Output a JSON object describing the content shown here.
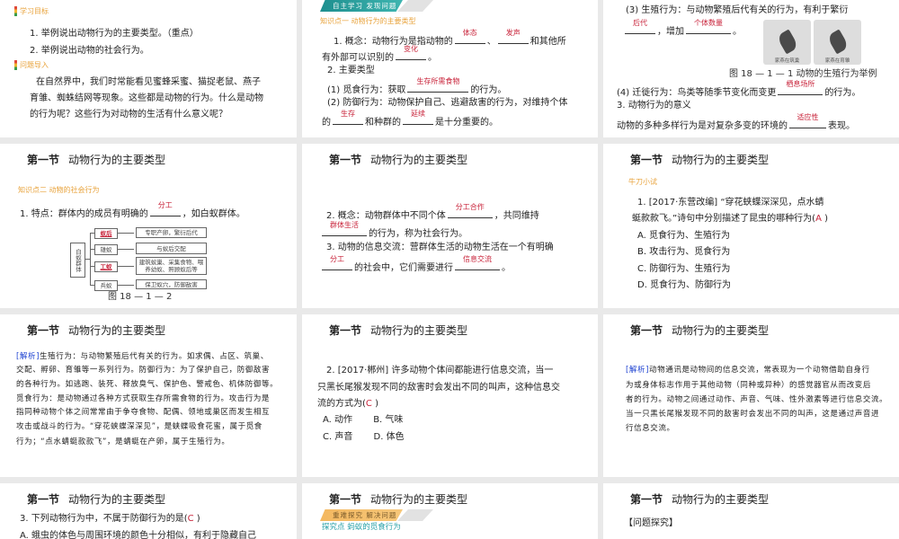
{
  "header": {
    "section": "第一节",
    "name": "动物行为的主要类型"
  },
  "slides": [
    {
      "blocks": [
        {
          "type": "tag",
          "text": "学习目标",
          "bar": true
        },
        {
          "type": "p",
          "segs": [
            "1. 举例说出动物行为的主要类型。（重点）"
          ]
        },
        {
          "type": "p",
          "segs": [
            "2. 举例说出动物的社会行为。"
          ]
        },
        {
          "type": "tag",
          "text": "问题导入",
          "bar": true
        },
        {
          "type": "p",
          "segs": [
            "在自然界中，我们时常能看见蜜蜂采蜜、猫捉老鼠、燕子"
          ]
        },
        {
          "type": "p",
          "segs": [
            "育雏、蜘蛛结网等现象。这些都是动物的行为。什么是动物"
          ]
        },
        {
          "type": "p",
          "segs": [
            "的行为呢？这些行为对动物的生活有什么意义呢？"
          ]
        }
      ]
    },
    {
      "banner": {
        "text": "自主学习 发现问题",
        "style": "teal"
      },
      "blocks": [
        {
          "type": "tag",
          "text": "知识点一  动物行为的主要类型"
        },
        {
          "type": "p",
          "segs": [
            "1. 概念：动物行为是指动物的",
            {
              "blank": "体态"
            },
            "、",
            {
              "blank": "发声"
            },
            "和其他所"
          ]
        },
        {
          "type": "p",
          "segs": [
            "有外部可以识别的",
            {
              "blank": "变化"
            },
            "。"
          ]
        },
        {
          "type": "p",
          "segs": [
            "2. 主要类型"
          ]
        },
        {
          "type": "p",
          "segs": [
            "(1) 觅食行为：获取",
            {
              "blank": "生存所需食物"
            },
            "的行为。"
          ]
        },
        {
          "type": "p",
          "segs": [
            "(2) 防御行为：动物保护自己、逃避敌害的行为，对维持个体"
          ]
        },
        {
          "type": "p",
          "segs": [
            "的",
            {
              "blank": "生存"
            },
            "和种群的",
            {
              "blank": "延续"
            },
            "是十分重要的。"
          ]
        }
      ]
    },
    {
      "photos": [
        "家燕在筑巢",
        "家燕在育雏"
      ],
      "blocks": [
        {
          "type": "p",
          "segs": [
            "(3) 生殖行为：与动物繁殖后代有关的行为，有利于繁衍"
          ]
        },
        {
          "type": "p",
          "segs": [
            {
              "blank": "后代"
            },
            "，增加",
            {
              "blank": "个体数量"
            },
            "。"
          ]
        },
        {
          "type": "caption",
          "text": "图 18 — 1 — 1  动物的生殖行为举例"
        },
        {
          "type": "p",
          "segs": [
            "(4) 迁徙行为：鸟类等随季节变化而变更",
            {
              "blank": "栖息场所"
            },
            "的行为。"
          ]
        },
        {
          "type": "p",
          "segs": [
            "3. 动物行为的意义"
          ]
        },
        {
          "type": "p",
          "segs": [
            "动物的多种多样行为是对复杂多变的环境的",
            {
              "blank": "适应性"
            },
            "表现。"
          ]
        }
      ]
    },
    {
      "title": true,
      "diagram": {
        "root": "白蚁群体",
        "rows": [
          {
            "role": "蚁后",
            "desc": "专职产卵，繁衍后代",
            "highlight": true
          },
          {
            "role": "雄蚁",
            "desc": "与蚁后交配",
            "highlight": false
          },
          {
            "role": "工蚁",
            "desc": "建筑蚁巢、采集食物、喂养幼蚁、照顾蚁后等",
            "highlight": true
          },
          {
            "role": "兵蚁",
            "desc": "保卫蚁穴，防御敌害",
            "highlight": false
          }
        ]
      },
      "blocks": [
        {
          "type": "tag",
          "text": "知识点二  动物的社会行为"
        },
        {
          "type": "p",
          "segs": [
            "1. 特点：群体内的成员有明确的",
            {
              "blank": "分工"
            },
            "，如白蚁群体。"
          ]
        },
        {
          "type": "caption",
          "text": "图 18 — 1 — 2"
        }
      ]
    },
    {
      "title": true,
      "blocks": [
        {
          "type": "p",
          "segs": [
            "2. 概念：动物群体中不同个体",
            {
              "blank": "分工合作"
            },
            "，共同维持"
          ]
        },
        {
          "type": "p",
          "segs": [
            {
              "blank": "群体生活"
            },
            "的行为，称为社会行为。"
          ]
        },
        {
          "type": "p",
          "segs": [
            "3. 动物的信息交流：营群体生活的动物生活在一个有明确"
          ]
        },
        {
          "type": "p",
          "segs": [
            {
              "blank": "分工"
            },
            "的社会中，它们需要进行",
            {
              "blank": "信息交流"
            },
            "。"
          ]
        }
      ]
    },
    {
      "title": true,
      "blocks": [
        {
          "type": "tag",
          "text": "牛刀小试"
        },
        {
          "type": "p",
          "segs": [
            "1. [2017·东营改编] “穿花蛱蝶深深见，点水蜻"
          ]
        },
        {
          "type": "p",
          "segs": [
            "蜓款款飞。”诗句中分别描述了昆虫的哪种行为(",
            {
              "ans": "A"
            },
            " )"
          ]
        },
        {
          "type": "p",
          "segs": [
            "A. 觅食行为、生殖行为"
          ]
        },
        {
          "type": "p",
          "segs": [
            "B. 攻击行为、觅食行为"
          ]
        },
        {
          "type": "p",
          "segs": [
            "C. 防御行为、生殖行为"
          ]
        },
        {
          "type": "p",
          "segs": [
            "D. 觅食行为、防御行为"
          ]
        }
      ]
    },
    {
      "title": true,
      "blocks": [
        {
          "type": "s",
          "segs": [
            {
              "label": "[解析]"
            },
            "生殖行为：与动物繁殖后代有关的行为。如求偶、占区、筑巢、"
          ]
        },
        {
          "type": "s",
          "segs": [
            "交配、孵卵、育雏等一系列行为。防御行为：为了保护自己，防御敌害"
          ]
        },
        {
          "type": "s",
          "segs": [
            "的各种行为。如逃跑、装死、释放臭气、保护色、警戒色、机体防御等。"
          ]
        },
        {
          "type": "s",
          "segs": [
            "觅食行为：是动物通过各种方式获取生存所需食物的行为。攻击行为是"
          ]
        },
        {
          "type": "s",
          "segs": [
            "指同种动物个体之间常常由于争夺食物、配偶、领地或巢区而发生相互"
          ]
        },
        {
          "type": "s",
          "segs": [
            "攻击或战斗的行为。“穿花蛱蝶深深见”，是蛱蝶吸食花蜜，属于觅食"
          ]
        },
        {
          "type": "s",
          "segs": [
            "行为；“点水蜻蜓款款飞”，是蜻蜓在产卵，属于生殖行为。"
          ]
        }
      ]
    },
    {
      "title": true,
      "blocks": [
        {
          "type": "p",
          "segs": [
            "2. [2017·郴州] 许多动物个体间都能进行信息交流，当一"
          ]
        },
        {
          "type": "p",
          "segs": [
            "只黑长尾猴发现不同的敌害时会发出不同的叫声，这种信息交"
          ]
        },
        {
          "type": "p",
          "segs": [
            "流的方式为(",
            {
              "ans": "C"
            },
            " )"
          ]
        },
        {
          "type": "p",
          "segs": [
            "A. 动作　　 B. 气味"
          ]
        },
        {
          "type": "p",
          "segs": [
            "C. 声音　　 D. 体色"
          ]
        }
      ]
    },
    {
      "title": true,
      "blocks": [
        {
          "type": "s",
          "segs": [
            {
              "label": "[解析]"
            },
            "动物通讯是动物间的信息交流，常表现为一个动物借助自身行"
          ]
        },
        {
          "type": "s",
          "segs": [
            "为或身体标志作用于其他动物（同种或异种）的感觉器官从而改变后"
          ]
        },
        {
          "type": "s",
          "segs": [
            "者的行为。动物之间通过动作、声音、气味、性外激素等进行信息交流。"
          ]
        },
        {
          "type": "s",
          "segs": [
            "当一只黑长尾猴发现不同的敌害时会发出不同的叫声，这是通过声音进"
          ]
        },
        {
          "type": "s",
          "segs": [
            "行信息交流。"
          ]
        }
      ]
    },
    {
      "title": true,
      "blocks": [
        {
          "type": "p",
          "segs": [
            "3. 下列动物行为中，不属于防御行为的是(",
            {
              "ans": "C"
            },
            " )"
          ]
        },
        {
          "type": "p",
          "segs": [
            "A. 蛾虫的体色与周围环境的颜色十分相似，有利于隐藏自己"
          ]
        }
      ]
    },
    {
      "title": true,
      "banner": {
        "text": "重难探究 解决问题",
        "style": "orange"
      },
      "blocks": [
        {
          "type": "teal",
          "text": "探究点  蚂蚁的觅食行为"
        }
      ]
    },
    {
      "title": true,
      "blocks": [
        {
          "type": "p",
          "segs": [
            "【问题探究】"
          ]
        }
      ]
    }
  ]
}
